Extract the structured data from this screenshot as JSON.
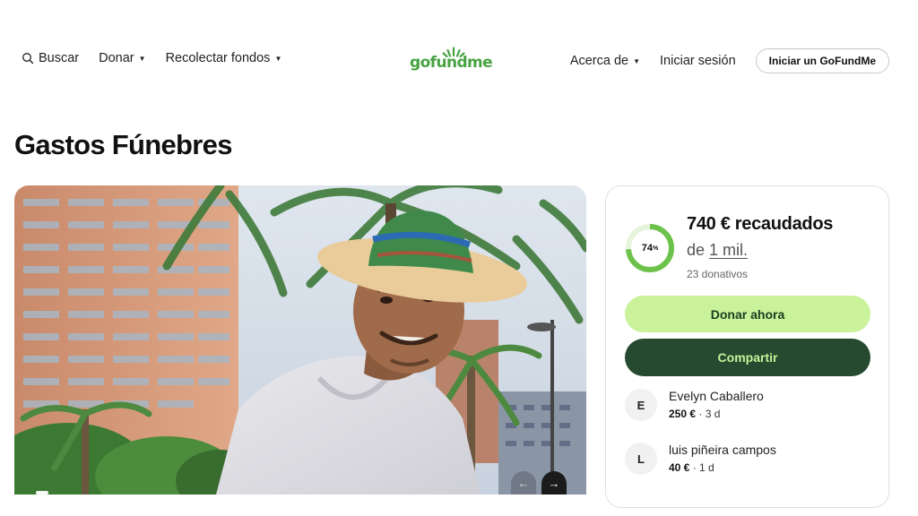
{
  "header": {
    "search_label": "Buscar",
    "donate_label": "Donar",
    "fundraise_label": "Recolectar fondos",
    "logo_text": "gofundme",
    "about_label": "Acerca de",
    "login_label": "Iniciar sesión",
    "start_label": "Iniciar un GoFundMe"
  },
  "campaign": {
    "title": "Gastos Fúnebres"
  },
  "gallery": {
    "prev_icon": "←",
    "next_icon": "→",
    "slide_count": 1
  },
  "donation_card": {
    "progress_percent": 74,
    "progress_label": "74",
    "progress_sup": "%",
    "raised_text": "740 € recaudados",
    "goal_prefix": "de",
    "goal_amount": "1 mil.",
    "donations_count": "23 donativos",
    "donate_button": "Donar ahora",
    "share_button": "Compartir",
    "donors": [
      {
        "initial": "E",
        "name": "Evelyn Caballero",
        "amount": "250 €",
        "time": "· 3 d"
      },
      {
        "initial": "L",
        "name": "luis piñeira campos",
        "amount": "40 €",
        "time": "· 1 d"
      }
    ]
  },
  "colors": {
    "brand_green": "#47a342",
    "donate_bg": "#c9f29b",
    "share_bg": "#254a2f",
    "ring_track": "#e6f4dc",
    "ring_fill": "#6cc24a"
  }
}
